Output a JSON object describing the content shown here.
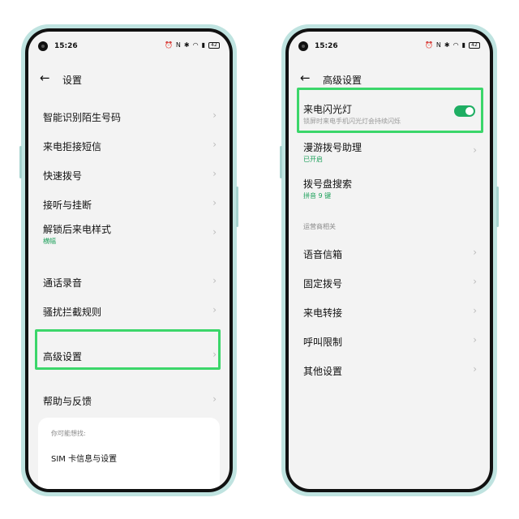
{
  "colors": {
    "accent_green": "#1fae63",
    "highlight_green": "#3bd66a",
    "frame": "#bfe3e0"
  },
  "left": {
    "status": {
      "time": "15:26",
      "battery": "42"
    },
    "nav": {
      "back_icon": "←",
      "title": "设置"
    },
    "items": [
      {
        "label": "智能识别陌生号码"
      },
      {
        "label": "来电拒接短信"
      },
      {
        "label": "快速拨号"
      },
      {
        "label": "接听与挂断"
      },
      {
        "label": "解锁后来电样式",
        "sub": "横幅"
      },
      {
        "label": "通话录音"
      },
      {
        "label": "骚扰拦截规则"
      },
      {
        "label": "高级设置"
      },
      {
        "label": "帮助与反馈"
      }
    ],
    "card": {
      "hint": "你可能想找:",
      "item": "SIM 卡信息与设置"
    }
  },
  "right": {
    "status": {
      "time": "15:26",
      "battery": "42"
    },
    "nav": {
      "back_icon": "←",
      "title": "高级设置"
    },
    "flash": {
      "label": "来电闪光灯",
      "sub": "锁屏时来电手机闪光灯会持续闪烁",
      "enabled": true
    },
    "items": [
      {
        "label": "漫游拨号助理",
        "sub": "已开启"
      },
      {
        "label": "拨号盘搜索",
        "sub": "拼音 9 键"
      }
    ],
    "section_header": "运营商相关",
    "carrier_items": [
      {
        "label": "语音信箱"
      },
      {
        "label": "固定拨号"
      },
      {
        "label": "来电转接"
      },
      {
        "label": "呼叫限制"
      },
      {
        "label": "其他设置"
      }
    ]
  },
  "chevron": "›"
}
